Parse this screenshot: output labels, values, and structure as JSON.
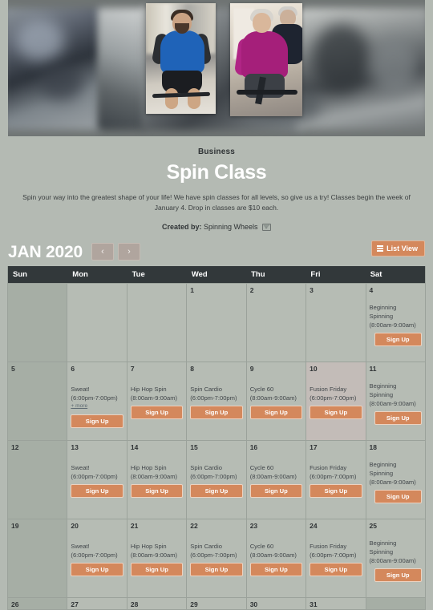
{
  "hero": {
    "alt": "spin class cyclists"
  },
  "intro": {
    "business_label": "Business",
    "title": "Spin Class",
    "description": "Spin your way into the greatest shape of your life! We have spin classes for all levels, so give us a try! Classes begin the week of January 4. Drop in classes are $10 each.",
    "created_by_label": "Created by:",
    "created_by_name": "Spinning Wheels",
    "mail_icon": "envelope-icon"
  },
  "toolbar": {
    "month": "JAN 2020",
    "prev_label": "‹",
    "next_label": "›",
    "list_view_label": "List View",
    "list_icon": "list-icon",
    "accent_color": "#d4885c"
  },
  "calendar": {
    "dow": [
      "Sun",
      "Mon",
      "Tue",
      "Wed",
      "Thu",
      "Fri",
      "Sat"
    ],
    "signup_label": "Sign Up",
    "more_label": "+ more",
    "weeks": [
      [
        {
          "day": "",
          "off": true,
          "events": []
        },
        {
          "day": "",
          "off": false,
          "events": []
        },
        {
          "day": "",
          "off": false,
          "events": []
        },
        {
          "day": "1",
          "off": false,
          "events": []
        },
        {
          "day": "2",
          "off": false,
          "events": []
        },
        {
          "day": "3",
          "off": false,
          "events": []
        },
        {
          "day": "4",
          "off": false,
          "wrap": true,
          "events": [
            {
              "name": "Beginning Spinning",
              "time": "(8:00am-9:00am)"
            }
          ]
        }
      ],
      [
        {
          "day": "5",
          "off": true,
          "events": []
        },
        {
          "day": "6",
          "off": false,
          "more": true,
          "events": [
            {
              "name": "Sweat!",
              "time": "(6:00pm-7:00pm)"
            }
          ]
        },
        {
          "day": "7",
          "off": false,
          "events": [
            {
              "name": "Hip Hop Spin",
              "time": "(8:00am-9:00am)"
            }
          ]
        },
        {
          "day": "8",
          "off": false,
          "events": [
            {
              "name": "Spin Cardio",
              "time": "(6:00pm-7:00pm)"
            }
          ]
        },
        {
          "day": "9",
          "off": false,
          "events": [
            {
              "name": "Cycle 60",
              "time": "(8:00am-9:00am)"
            }
          ]
        },
        {
          "day": "10",
          "off": false,
          "sel": true,
          "events": [
            {
              "name": "Fusion Friday",
              "time": "(6:00pm-7:00pm)"
            }
          ]
        },
        {
          "day": "11",
          "off": false,
          "wrap": true,
          "events": [
            {
              "name": "Beginning Spinning",
              "time": "(8:00am-9:00am)"
            }
          ]
        }
      ],
      [
        {
          "day": "12",
          "off": true,
          "events": []
        },
        {
          "day": "13",
          "off": false,
          "events": [
            {
              "name": "Sweat!",
              "time": "(6:00pm-7:00pm)"
            }
          ]
        },
        {
          "day": "14",
          "off": false,
          "events": [
            {
              "name": "Hip Hop Spin",
              "time": "(8:00am-9:00am)"
            }
          ]
        },
        {
          "day": "15",
          "off": false,
          "events": [
            {
              "name": "Spin Cardio",
              "time": "(6:00pm-7:00pm)"
            }
          ]
        },
        {
          "day": "16",
          "off": false,
          "events": [
            {
              "name": "Cycle 60",
              "time": "(8:00am-9:00am)"
            }
          ]
        },
        {
          "day": "17",
          "off": false,
          "events": [
            {
              "name": "Fusion Friday",
              "time": "(6:00pm-7:00pm)"
            }
          ]
        },
        {
          "day": "18",
          "off": false,
          "wrap": true,
          "events": [
            {
              "name": "Beginning Spinning",
              "time": "(8:00am-9:00am)"
            }
          ]
        }
      ],
      [
        {
          "day": "19",
          "off": true,
          "events": []
        },
        {
          "day": "20",
          "off": false,
          "events": [
            {
              "name": "Sweat!",
              "time": "(6:00pm-7:00pm)"
            }
          ]
        },
        {
          "day": "21",
          "off": false,
          "events": [
            {
              "name": "Hip Hop Spin",
              "time": "(8:00am-9:00am)"
            }
          ]
        },
        {
          "day": "22",
          "off": false,
          "events": [
            {
              "name": "Spin Cardio",
              "time": "(6:00pm-7:00pm)"
            }
          ]
        },
        {
          "day": "23",
          "off": false,
          "events": [
            {
              "name": "Cycle 60",
              "time": "(8:00am-9:00am)"
            }
          ]
        },
        {
          "day": "24",
          "off": false,
          "events": [
            {
              "name": "Fusion Friday",
              "time": "(6:00pm-7:00pm)"
            }
          ]
        },
        {
          "day": "25",
          "off": false,
          "wrap": true,
          "events": [
            {
              "name": "Beginning Spinning",
              "time": "(8:00am-9:00am)"
            }
          ]
        }
      ],
      [
        {
          "day": "26",
          "off": true,
          "events": []
        },
        {
          "day": "27",
          "off": false,
          "events": []
        },
        {
          "day": "28",
          "off": false,
          "events": []
        },
        {
          "day": "29",
          "off": false,
          "events": []
        },
        {
          "day": "30",
          "off": false,
          "events": []
        },
        {
          "day": "31",
          "off": false,
          "events": []
        },
        {
          "day": "",
          "off": true,
          "events": []
        }
      ]
    ]
  }
}
